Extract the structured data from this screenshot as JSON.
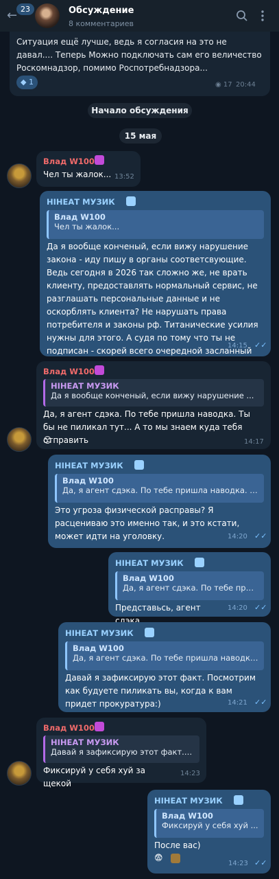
{
  "header": {
    "badge": "23",
    "title": "Обсуждение",
    "subtitle": "8 комментариев",
    "search_icon": "search-icon",
    "menu_icon": "more-vertical-icon"
  },
  "pinned": {
    "text": "Ситуация ещё лучше, ведь я согласия на это не давал.... Теперь Можно подключать сам его величество Роскомнадзор, помимо Роспотребнадзора...",
    "reaction_count": "1",
    "views": "17",
    "time": "20:44"
  },
  "service": {
    "start": "Начало обсуждения",
    "date": "15 мая"
  },
  "messages": [
    {
      "name": "Влад W100",
      "text": "Чел ты жалок...",
      "time": "13:52"
    },
    {
      "name": "НIНЕАТ МУЗИК",
      "quote_name": "Влад W100",
      "quote_text": "Чел ты жалок...",
      "text": "Да я вообще конченый, если вижу нарушение закона - иду пишу в органы соответсвующие. Ведь сегодня в 2026 так сложно же, не врать клиенту, предоставлять нормальный сервис, не разглашать персональные данные и не оскорблять клиента? Не нарушать права потребителя и законы рф. Титанические усилия нужны для этого. А судя по тому что ты не подписан - скорей всего очередной засланный казачок.",
      "time": "14:15"
    },
    {
      "name": "Влад W100",
      "quote_name": "НIНЕАТ МУЗИК",
      "quote_text": "Да я вообще конченый, если вижу нарушение ...",
      "text": "Да, я агент сдэка. По тебе пришла наводка. Ты бы не пиликал тут... А то мы знаем куда тебя отправить",
      "emoji": "😏",
      "time": "14:17"
    },
    {
      "name": "НIНЕАТ МУЗИК",
      "quote_name": "Влад W100",
      "quote_text": "Да, я агент сдэка. По тебе пришла наводка. Т...",
      "text": "Это угроза физической расправы? Я расцениваю это именно так, и это кстати, может идти на уголовку.",
      "time": "14:20"
    },
    {
      "name": "НIНЕАТ МУЗИК",
      "quote_name": "Влад W100",
      "quote_text": "Да, я агент сдэка. По тебе при...",
      "text": "Представьсь, агент сдэка",
      "time": "14:20"
    },
    {
      "name": "НIНЕАТ МУЗИК",
      "quote_name": "Влад W100",
      "quote_text": "Да, я агент сдэка. По тебе пришла наводка....",
      "text": "Давай я зафиксирую этот факт. Посмотрим как будуете пиликать вы, когда к вам придет прокуратура:)",
      "time": "14:21"
    },
    {
      "name": "Влад W100",
      "quote_name": "НIНЕАТ МУЗИК",
      "quote_text": "Давай я зафиксирую этот факт. П...",
      "text": "Фиксируй у себя хуй за щекой",
      "time": "14:23"
    },
    {
      "name": "НIНЕАТ МУЗИК",
      "quote_name": "Влад W100",
      "quote_text": "Фиксируй у себя хуй ...",
      "text": "После вас)",
      "emoji": "😨",
      "time": "14:23"
    }
  ],
  "colors": {
    "background": "#0e1621",
    "incoming": "#182533",
    "outgoing": "#2b5278",
    "name_red": "#ef6a6a",
    "link_blue": "#9ad1ff"
  }
}
